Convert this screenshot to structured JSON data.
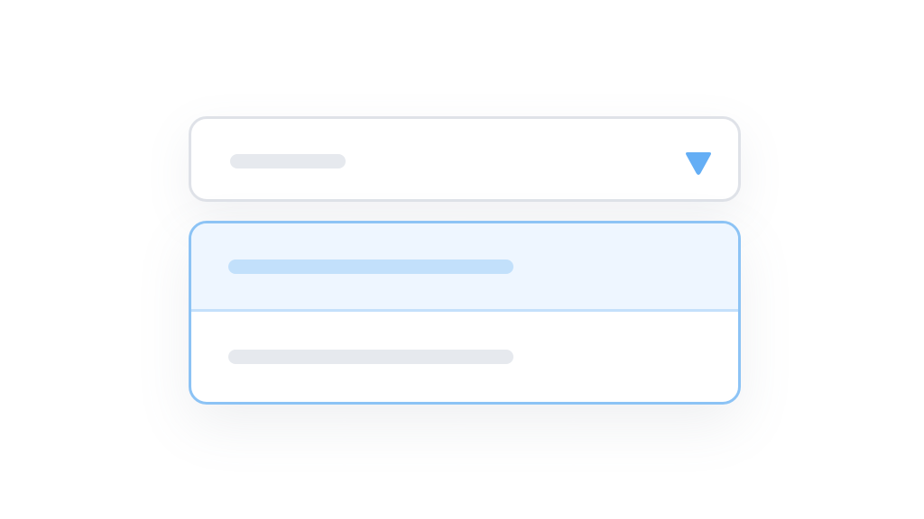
{
  "colors": {
    "accent": "#64aef5",
    "field_border": "#dfe2e8",
    "panel_border": "#8cc3f5",
    "selected_bg": "#eef6ff",
    "selected_line": "#c2e0fb",
    "placeholder_line": "#e6e9ee"
  },
  "select": {
    "caret_icon": "triangle-down-icon"
  },
  "options": [
    {
      "state": "selected"
    },
    {
      "state": "default"
    }
  ]
}
